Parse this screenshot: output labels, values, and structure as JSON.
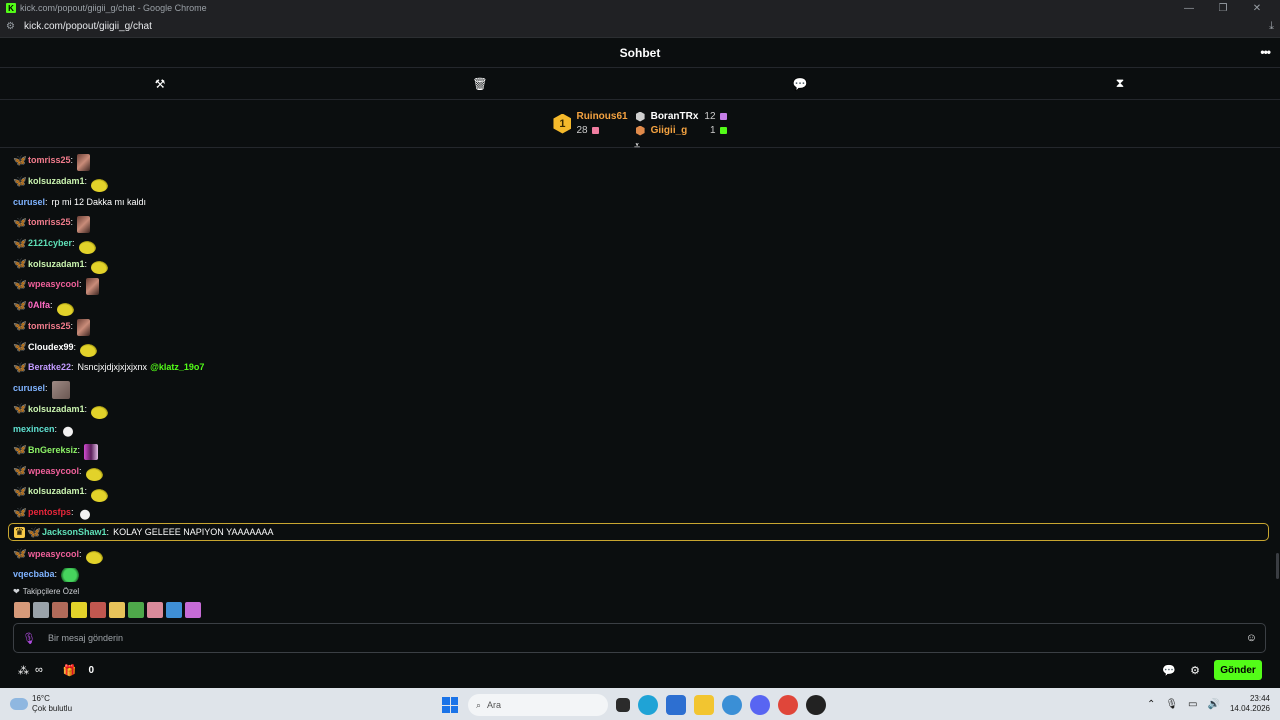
{
  "window": {
    "title": "kick.com/popout/giigii_g/chat - Google Chrome",
    "url": "kick.com/popout/giigii_g/chat"
  },
  "chat": {
    "title": "Sohbet"
  },
  "leaderboard": {
    "first": {
      "rank": "1",
      "name": "Ruinous61",
      "count": "28"
    },
    "others": [
      {
        "name": "BoranTRx",
        "count": "12",
        "name_color": "#ffffff",
        "gift_color": "#c67ee8"
      },
      {
        "name": "Giigii_g",
        "count": "1",
        "name_color": "#f5a341",
        "gift_color": "#53fc18"
      }
    ]
  },
  "messages": [
    {
      "user": "tomriss25",
      "user_color": "#f27c8c",
      "badge_color": "#f5a341",
      "emote": "girl",
      "text": ""
    },
    {
      "user": "kolsuzadam1",
      "user_color": "#cbf5b0",
      "badge_color": "#f08bd6",
      "emote": "pepe",
      "text": ""
    },
    {
      "user": "curusel",
      "user_color": "#7fb3ff",
      "badge_color": "",
      "emote": "",
      "text": "rp mi 12 Dakka mı kaldı"
    },
    {
      "user": "tomriss25",
      "user_color": "#f27c8c",
      "badge_color": "#f5a341",
      "emote": "girl",
      "text": ""
    },
    {
      "user": "2121cyber",
      "user_color": "#5fe0b8",
      "badge_color": "#f08bd6",
      "emote": "pepe",
      "text": ""
    },
    {
      "user": "kolsuzadam1",
      "user_color": "#cbf5b0",
      "badge_color": "#f08bd6",
      "emote": "pepe",
      "text": ""
    },
    {
      "user": "wpeasycool",
      "user_color": "#f0609a",
      "badge_color": "#f08bd6",
      "emote": "girl",
      "text": ""
    },
    {
      "user": "0Alfa",
      "user_color": "#ff6bc4",
      "badge_color": "#f08bd6",
      "emote": "pepe",
      "text": ""
    },
    {
      "user": "tomriss25",
      "user_color": "#f27c8c",
      "badge_color": "#f5a341",
      "emote": "girl",
      "text": ""
    },
    {
      "user": "Cloudex99",
      "user_color": "#ffffff",
      "badge_color": "#f08bd6",
      "emote": "pepe",
      "text": ""
    },
    {
      "user": "Beratke22",
      "user_color": "#c39bff",
      "badge_color": "#f08bd6",
      "emote": "",
      "text": "Nsncjxjdjxjxjxjxnx",
      "mention": "@klatz_19o7"
    },
    {
      "user": "curusel",
      "user_color": "#7fb3ff",
      "badge_color": "",
      "emote": "cat",
      "text": ""
    },
    {
      "user": "kolsuzadam1",
      "user_color": "#cbf5b0",
      "badge_color": "#f08bd6",
      "emote": "pepe",
      "text": ""
    },
    {
      "user": "mexincen",
      "user_color": "#5fe0d0",
      "badge_color": "",
      "emote": "hand",
      "text": ""
    },
    {
      "user": "BnGereksiz",
      "user_color": "#8cf266",
      "badge_color": "#f5d23b",
      "emote": "duo",
      "text": ""
    },
    {
      "user": "wpeasycool",
      "user_color": "#f0609a",
      "badge_color": "#f08bd6",
      "emote": "pepe",
      "text": ""
    },
    {
      "user": "kolsuzadam1",
      "user_color": "#cbf5b0",
      "badge_color": "#f08bd6",
      "emote": "pepe",
      "text": ""
    },
    {
      "user": "pentosfps",
      "user_color": "#e8263a",
      "badge_color": "#f08bd6",
      "emote": "hand",
      "text": ""
    },
    {
      "user": "JacksonShaw1",
      "user_color": "#5fe0b8",
      "badge_color": "#f5a341",
      "emote": "",
      "text": "KOLAY GELEEE NAPIYON YAAAAAAA",
      "highlight": true
    },
    {
      "user": "wpeasycool",
      "user_color": "#f0609a",
      "badge_color": "#f08bd6",
      "emote": "pepe",
      "text": ""
    },
    {
      "user": "vqecbaba",
      "user_color": "#7fb3ff",
      "badge_color": "",
      "emote": "blob",
      "text": ""
    }
  ],
  "followers_only": {
    "label": "Takipçilere Özel",
    "emote_colors": [
      "#d69a7a",
      "#9aa3aa",
      "#b26b5a",
      "#e2d22a",
      "#c0574f",
      "#e8c35a",
      "#4ea84a",
      "#d98a9a",
      "#3f8fd6",
      "#c66bd6"
    ]
  },
  "input": {
    "placeholder": "Bir mesaj gönderin"
  },
  "bottombar": {
    "count": "0",
    "send_label": "Gönder"
  },
  "taskbar": {
    "temperature": "16°C",
    "weather": "Çok bulutlu",
    "search": "Ara",
    "time": "23:44",
    "date": "14.04.2026"
  }
}
